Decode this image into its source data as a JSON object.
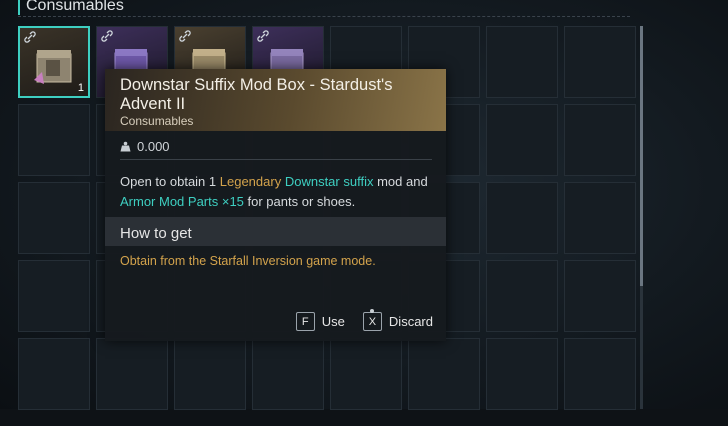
{
  "inventory": {
    "section_title": "Consumables",
    "first_slot_quantity": "1"
  },
  "tooltip": {
    "title": "Downstar Suffix Mod Box - Stardust's Advent II",
    "category": "Consumables",
    "weight": "0.000",
    "description": {
      "prefix": "Open to obtain 1 ",
      "legendary": "Legendary",
      "space": " ",
      "downstar": "Downstar suffix",
      "mid": " mod and ",
      "parts": "Armor Mod Parts ×15",
      "suffix": " for pants or shoes."
    },
    "how_to_get_label": "How to get",
    "source": "Obtain from the Starfall Inversion game mode.",
    "actions": [
      {
        "key": "F",
        "label": "Use"
      },
      {
        "key": "X",
        "label": "Discard"
      }
    ]
  },
  "colors": {
    "accent_teal": "#3ecfc1",
    "legendary_gold": "#d3a34c"
  },
  "icons": [
    "link-icon",
    "weight-icon",
    "mod-box-icon"
  ]
}
